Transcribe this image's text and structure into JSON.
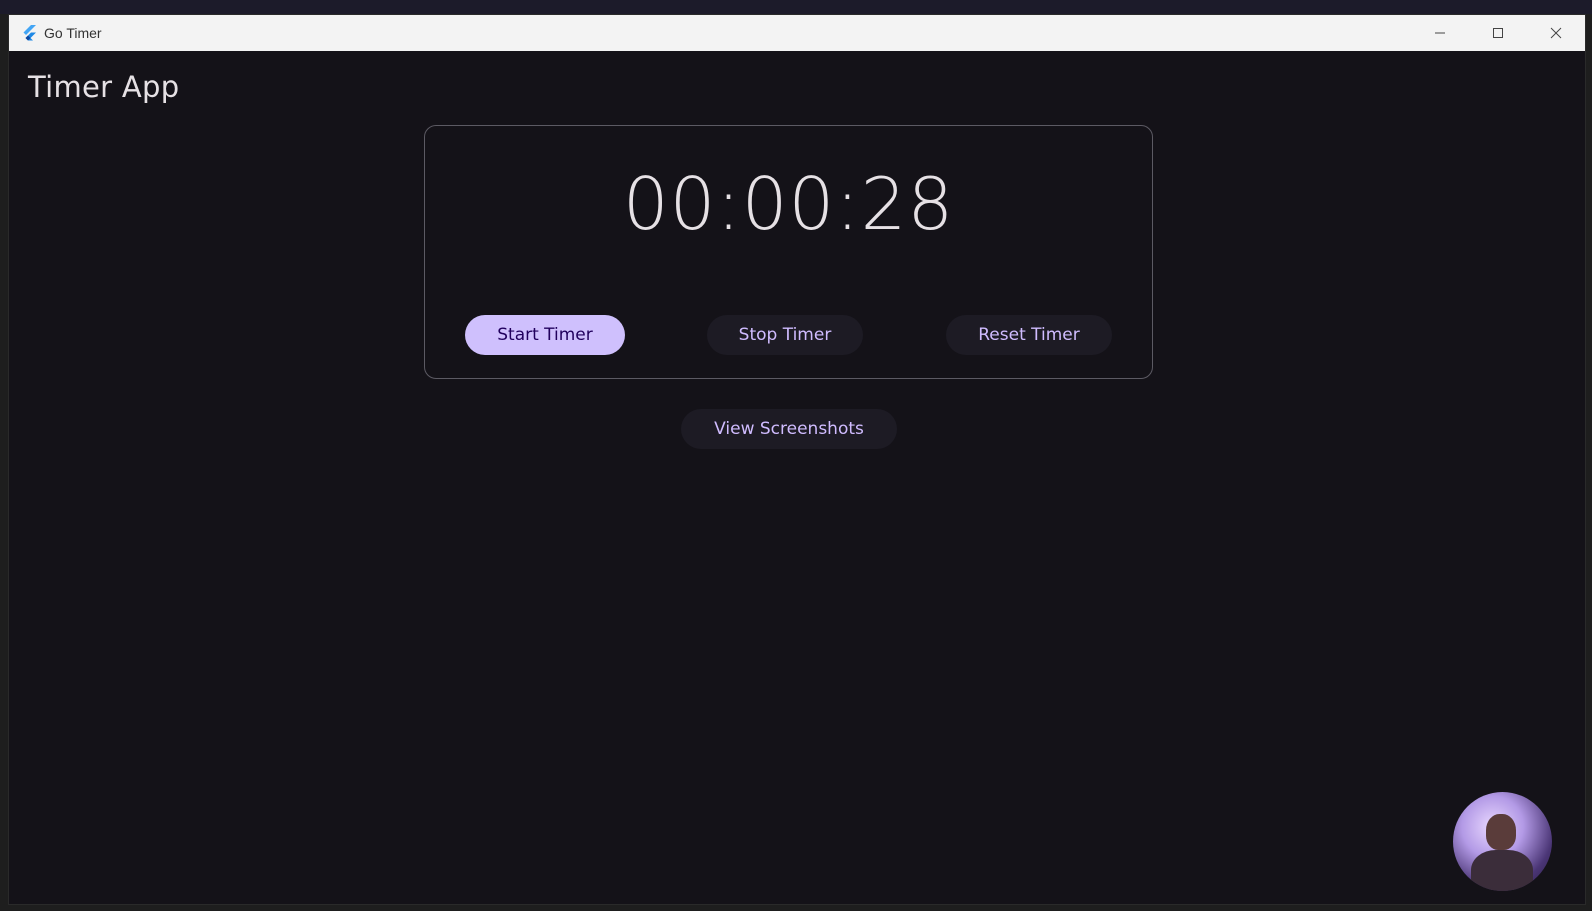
{
  "window": {
    "title": "Go Timer",
    "controls": {
      "minimize": "—",
      "maximize": "☐",
      "close": "✕"
    }
  },
  "app": {
    "title": "Timer App"
  },
  "timer": {
    "display": "00:00:28",
    "start_label": "Start Timer",
    "stop_label": "Stop Timer",
    "reset_label": "Reset Timer"
  },
  "screenshots": {
    "view_label": "View Screenshots"
  },
  "icons": {
    "app": "flutter-logo-icon",
    "minimize": "minimize-icon",
    "maximize": "maximize-icon",
    "close": "close-icon"
  },
  "colors": {
    "background": "#141218",
    "primary_button": "#cfc0fd",
    "tonal_button": "#1d1b24",
    "accent_text": "#d0bcff",
    "text": "#e6e1e5"
  }
}
